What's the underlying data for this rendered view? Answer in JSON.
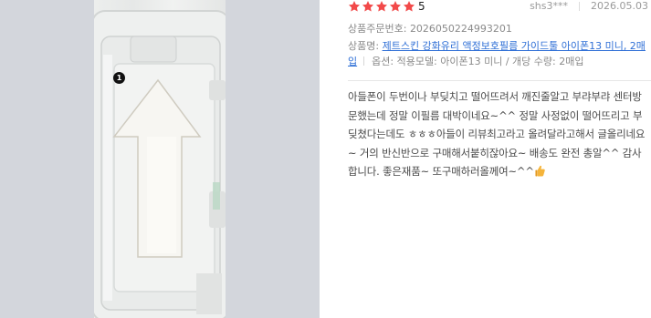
{
  "review": {
    "rating": 5,
    "score_label": "5",
    "user": "shs3***",
    "date": "2026.05.03",
    "order_number_label": "상품주문번호:",
    "order_number": "2026050224993201",
    "product_label": "상품명:",
    "product_name": "제트스킨 강화유리 액정보호필름 가이드툴 아이폰13 미니, 2매입",
    "options_label": "옵션:",
    "options_value": "적용모델: 아이폰13 미니 / 개당 수량: 2매입",
    "body": "아들폰이 두번이나 부딪치고 떨어뜨려서 깨진줄알고 부랴부랴 센터방문했는데 정말 이필름 대박이네요~^^ 정말 사정없이 떨어뜨리고 부딪쳤다는데도 ㅎㅎㅎ아들이 리뷰최고라고 올려달라고해서 글올리네요~ 거의 반신반으로 구매해서붙히잖아요~ 배송도 완전 총알^^ 감사합니다. 좋은재품~ 또구매하러올께여~^^",
    "emoji": "thumbs-up-icon"
  },
  "photo": {
    "badge_number": "1",
    "icon": "review-photo"
  },
  "colors": {
    "star": "#f24a4a",
    "link": "#2f6fd6",
    "muted": "#8a8a8a",
    "body_text": "#4a4a4a",
    "photo_backdrop": "#d3d6dc"
  }
}
